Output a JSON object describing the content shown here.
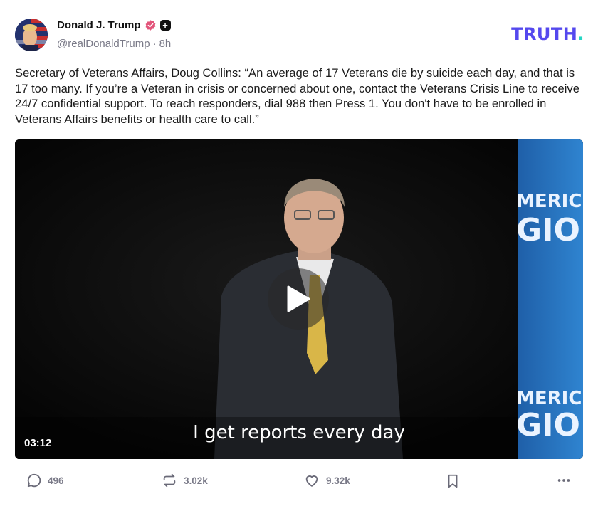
{
  "author": {
    "display_name": "Donald J. Trump",
    "handle": "@realDonaldTrump",
    "separator": "·",
    "time_ago": "8h"
  },
  "brand": {
    "text": "TRUTH",
    "dot": "."
  },
  "post": {
    "text": "Secretary of Veterans Affairs, Doug Collins: “An average of 17 Veterans die by suicide each day, and that is 17 too many. If you’re a Veteran in crisis or concerned about one, contact the Veterans Crisis Line to receive 24/7 confidential support. To reach responders, dial 988 then Press 1. You don't have to be enrolled in Veterans Affairs benefits or health care to call.”"
  },
  "video": {
    "caption": "I get reports every day",
    "duration": "03:12",
    "banner_text_top": "MERIC",
    "banner_text_mid": "GIO",
    "banner_text_bottom1": "MERIC",
    "banner_text_bottom2": "GIO"
  },
  "actions": {
    "replies": "496",
    "retruths": "3.02k",
    "likes": "9.32k"
  },
  "colors": {
    "brand_purple": "#5448ee",
    "brand_teal": "#25d6c5",
    "verified": "#e2547a",
    "muted": "#7a7a88"
  },
  "icons": [
    "verified-badge-icon",
    "plus-badge-icon",
    "play-icon",
    "reply-icon",
    "retruth-icon",
    "like-icon",
    "bookmark-icon",
    "more-icon"
  ]
}
